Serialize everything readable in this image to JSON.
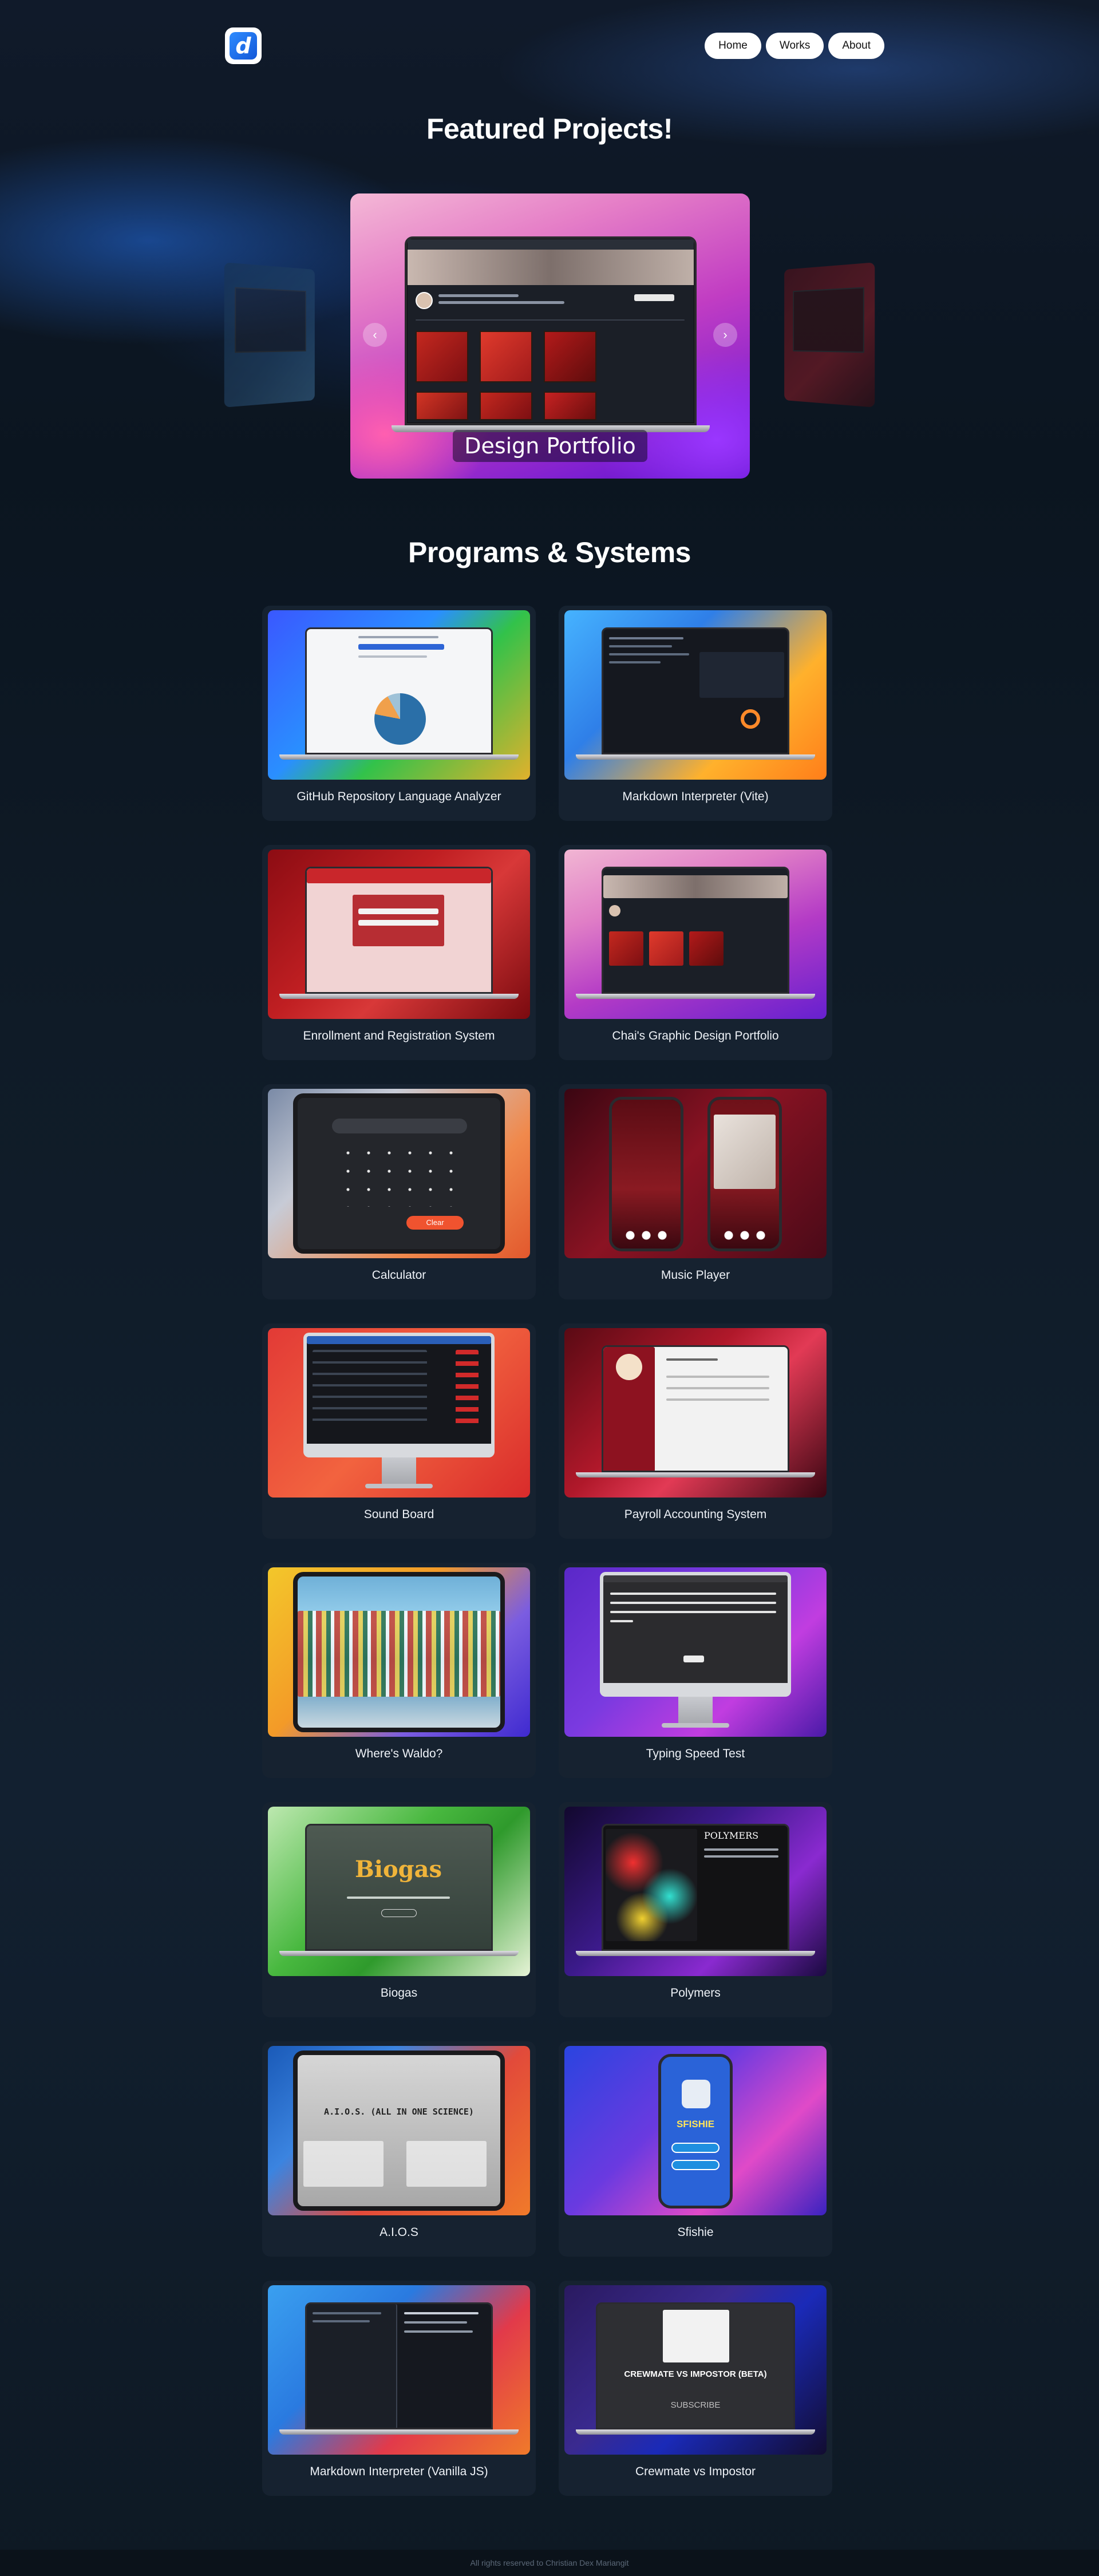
{
  "header": {
    "logo_letter": "d",
    "nav": [
      {
        "label": "Home"
      },
      {
        "label": "Works"
      },
      {
        "label": "About"
      }
    ]
  },
  "featured": {
    "title": "Featured Projects!",
    "current_caption": "Design Portfolio",
    "prev_icon": "chevron-left-icon",
    "next_icon": "chevron-right-icon"
  },
  "programs": {
    "title": "Programs & Systems",
    "projects": [
      {
        "label": "GitHub Repository Language Analyzer"
      },
      {
        "label": "Markdown Interpreter (Vite)"
      },
      {
        "label": "Enrollment and Registration System"
      },
      {
        "label": "Chai's Graphic Design Portfolio"
      },
      {
        "label": "Calculator"
      },
      {
        "label": "Music Player"
      },
      {
        "label": "Sound Board"
      },
      {
        "label": "Payroll Accounting System"
      },
      {
        "label": "Where's Waldo?"
      },
      {
        "label": "Typing Speed Test"
      },
      {
        "label": "Biogas"
      },
      {
        "label": "Polymers"
      },
      {
        "label": "A.I.O.S"
      },
      {
        "label": "Sfishie"
      },
      {
        "label": "Markdown Interpreter (Vanilla JS)"
      },
      {
        "label": "Crewmate vs Impostor"
      }
    ]
  },
  "thumb_text": {
    "calculator_clear": "Clear",
    "biogas": "Biogas",
    "polymers": "POLYMERS",
    "aios": "A.I.O.S. (ALL IN ONE SCIENCE)",
    "sfishie": "SFISHIE",
    "crewmate": "CREWMATE VS IMPOSTOR (BETA)",
    "subscribe": "SUBSCRIBE"
  },
  "footer": {
    "text": "All rights reserved to Christian Dex Mariangit"
  }
}
